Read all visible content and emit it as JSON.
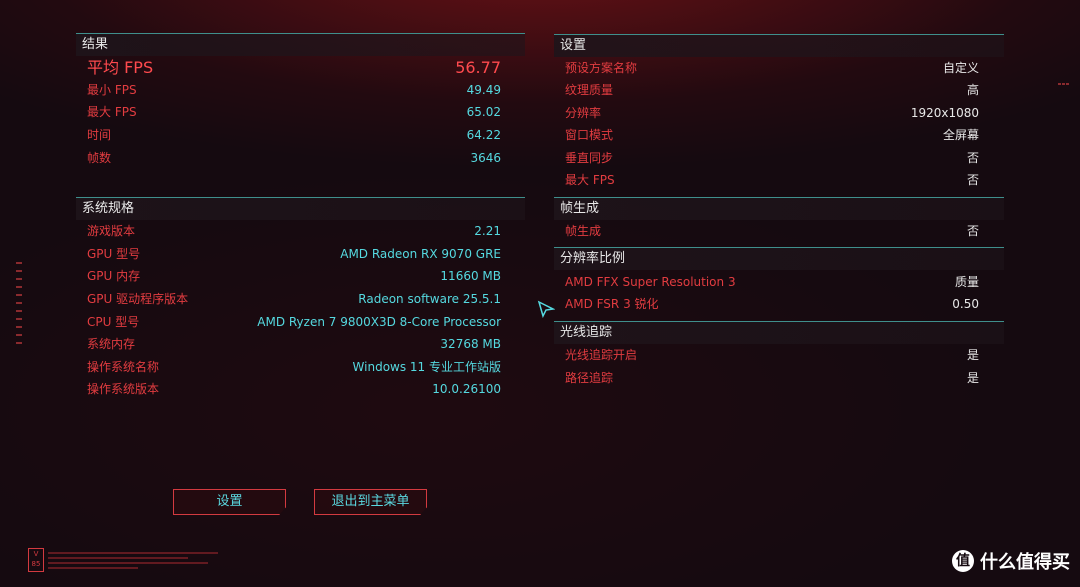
{
  "results": {
    "header": "结果",
    "rows": [
      {
        "label": "平均 FPS",
        "value": "56.77"
      },
      {
        "label": "最小 FPS",
        "value": "49.49"
      },
      {
        "label": "最大 FPS",
        "value": "65.02"
      },
      {
        "label": "时间",
        "value": "64.22"
      },
      {
        "label": "帧数",
        "value": "3646"
      }
    ]
  },
  "system": {
    "header": "系统规格",
    "rows": [
      {
        "label": "游戏版本",
        "value": "2.21"
      },
      {
        "label": "GPU 型号",
        "value": "AMD Radeon RX 9070 GRE"
      },
      {
        "label": "GPU 内存",
        "value": "11660 MB"
      },
      {
        "label": "GPU 驱动程序版本",
        "value": "Radeon software 25.5.1"
      },
      {
        "label": "CPU 型号",
        "value": "AMD Ryzen 7 9800X3D 8-Core Processor"
      },
      {
        "label": "系统内存",
        "value": "32768 MB"
      },
      {
        "label": "操作系统名称",
        "value": "Windows 11 专业工作站版"
      },
      {
        "label": "操作系统版本",
        "value": "10.0.26100"
      }
    ]
  },
  "settings": {
    "header": "设置",
    "rows": [
      {
        "label": "预设方案名称",
        "value": "自定义"
      },
      {
        "label": "纹理质量",
        "value": "高"
      },
      {
        "label": "分辨率",
        "value": "1920x1080"
      },
      {
        "label": "窗口模式",
        "value": "全屏幕"
      },
      {
        "label": "垂直同步",
        "value": "否"
      },
      {
        "label": "最大 FPS",
        "value": "否"
      }
    ]
  },
  "frame_gen": {
    "header": "帧生成",
    "rows": [
      {
        "label": "帧生成",
        "value": "否"
      }
    ]
  },
  "resolution_scaling": {
    "header": "分辨率比例",
    "rows": [
      {
        "label": "AMD FFX Super Resolution 3",
        "value": "质量"
      },
      {
        "label": "AMD FSR 3 锐化",
        "value": "0.50"
      }
    ]
  },
  "ray_tracing": {
    "header": "光线追踪",
    "rows": [
      {
        "label": "光线追踪开启",
        "value": "是"
      },
      {
        "label": "路径追踪",
        "value": "是"
      }
    ]
  },
  "buttons": {
    "settings_label": "设置",
    "exit_label": "退出到主菜单"
  },
  "logo_text": "V\n85",
  "watermark": {
    "icon_char": "值",
    "text": "什么值得买"
  },
  "colors": {
    "label_red": "#e23c40",
    "value_cyan": "#55d9e0",
    "header_line": "#3f8f8c",
    "background": "#150a10"
  }
}
